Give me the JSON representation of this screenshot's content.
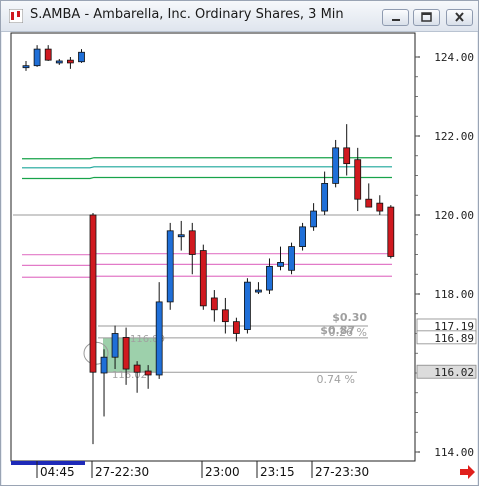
{
  "window": {
    "title": "S.AMBA - Ambarella, Inc. Ordinary Shares, 3 Min",
    "controls": [
      "minimize-icon",
      "restore-icon",
      "close-icon"
    ]
  },
  "colors": {
    "up": "#1f6fd8",
    "down": "#d0191f",
    "green_line": "#18a34a",
    "teal_line": "#1aa59a",
    "pink_line": "#e27ac8",
    "gray_line": "#9a9a9a",
    "label_gray": "#a0a0a0",
    "box_fill": "#7cc08f",
    "arrow": "#e0201c"
  },
  "chart_data": {
    "type": "candlestick",
    "ylim": [
      113.5,
      124.8
    ],
    "x_tick_labels": [
      "04:45",
      "27-22:30",
      "23:00",
      "23:15",
      "27-23:30"
    ],
    "y_ticks": [
      {
        "value": 124,
        "label": "124.00"
      },
      {
        "value": 122,
        "label": "122.00"
      },
      {
        "value": 120,
        "label": "120.00"
      },
      {
        "value": 118,
        "label": "118.00"
      },
      {
        "value": 114,
        "label": "114.00"
      }
    ],
    "price_flags": [
      {
        "value": 117.19,
        "label": "117.19"
      },
      {
        "value": 116.89,
        "label": "116.89"
      },
      {
        "value": 116.02,
        "label": "116.02"
      }
    ],
    "candles": [
      {
        "o": 123.78,
        "h": 123.9,
        "l": 123.65,
        "c": 123.78
      },
      {
        "o": 123.78,
        "h": 124.3,
        "l": 123.75,
        "c": 124.2
      },
      {
        "o": 124.2,
        "h": 124.3,
        "l": 123.9,
        "c": 123.92
      },
      {
        "o": 123.9,
        "h": 123.95,
        "l": 123.8,
        "c": 123.9
      },
      {
        "o": 123.92,
        "h": 124.0,
        "l": 123.7,
        "c": 123.85
      },
      {
        "o": 123.88,
        "h": 124.2,
        "l": 123.85,
        "c": 124.12
      },
      {
        "o": 120.0,
        "h": 120.05,
        "l": 114.2,
        "c": 116.02
      },
      {
        "o": 116.0,
        "h": 116.6,
        "l": 114.9,
        "c": 116.4
      },
      {
        "o": 116.4,
        "h": 117.2,
        "l": 116.1,
        "c": 117.0
      },
      {
        "o": 116.9,
        "h": 117.15,
        "l": 115.7,
        "c": 116.1
      },
      {
        "o": 116.2,
        "h": 116.3,
        "l": 115.5,
        "c": 116.02
      },
      {
        "o": 116.05,
        "h": 116.2,
        "l": 115.6,
        "c": 115.95
      },
      {
        "o": 115.95,
        "h": 118.3,
        "l": 115.85,
        "c": 117.8
      },
      {
        "o": 117.8,
        "h": 119.8,
        "l": 117.6,
        "c": 119.6
      },
      {
        "o": 119.5,
        "h": 119.85,
        "l": 119.1,
        "c": 119.5
      },
      {
        "o": 119.6,
        "h": 119.8,
        "l": 118.5,
        "c": 119.0
      },
      {
        "o": 119.1,
        "h": 119.25,
        "l": 117.6,
        "c": 117.7
      },
      {
        "o": 117.9,
        "h": 118.1,
        "l": 117.3,
        "c": 117.6
      },
      {
        "o": 117.6,
        "h": 117.9,
        "l": 117.0,
        "c": 117.3
      },
      {
        "o": 117.3,
        "h": 117.4,
        "l": 116.8,
        "c": 117.0
      },
      {
        "o": 117.1,
        "h": 118.4,
        "l": 117.0,
        "c": 118.3
      },
      {
        "o": 118.1,
        "h": 118.3,
        "l": 118.0,
        "c": 118.1
      },
      {
        "o": 118.1,
        "h": 118.9,
        "l": 118.0,
        "c": 118.7
      },
      {
        "o": 118.7,
        "h": 119.2,
        "l": 118.6,
        "c": 118.8
      },
      {
        "o": 118.6,
        "h": 119.3,
        "l": 118.5,
        "c": 119.2
      },
      {
        "o": 119.2,
        "h": 119.8,
        "l": 119.1,
        "c": 119.7
      },
      {
        "o": 119.7,
        "h": 120.3,
        "l": 119.6,
        "c": 120.1
      },
      {
        "o": 120.1,
        "h": 121.1,
        "l": 120.0,
        "c": 120.8
      },
      {
        "o": 120.8,
        "h": 121.9,
        "l": 120.7,
        "c": 121.7
      },
      {
        "o": 121.7,
        "h": 122.3,
        "l": 121.0,
        "c": 121.3
      },
      {
        "o": 121.4,
        "h": 121.7,
        "l": 120.1,
        "c": 120.4
      },
      {
        "o": 120.4,
        "h": 120.8,
        "l": 120.2,
        "c": 120.2
      },
      {
        "o": 120.3,
        "h": 120.5,
        "l": 120.0,
        "c": 120.1
      },
      {
        "o": 120.2,
        "h": 120.25,
        "l": 118.9,
        "c": 118.95
      }
    ],
    "horizontal_lines": [
      {
        "price": 121.45,
        "color": "green"
      },
      {
        "price": 121.22,
        "color": "teal"
      },
      {
        "price": 120.95,
        "color": "green"
      },
      {
        "price": 120.0,
        "color": "gray"
      },
      {
        "price": 119.02,
        "color": "pink"
      },
      {
        "price": 118.75,
        "color": "pink"
      },
      {
        "price": 118.45,
        "color": "pink"
      }
    ],
    "annotations": [
      {
        "dollar": "$0.30",
        "percent": "0.26 %",
        "from_label": "116.89",
        "from": 116.89,
        "to": 117.19
      },
      {
        "dollar": "$0.87",
        "percent": "0.74 %",
        "from_label": "116.02",
        "from": 116.02,
        "to": 116.89
      }
    ]
  }
}
